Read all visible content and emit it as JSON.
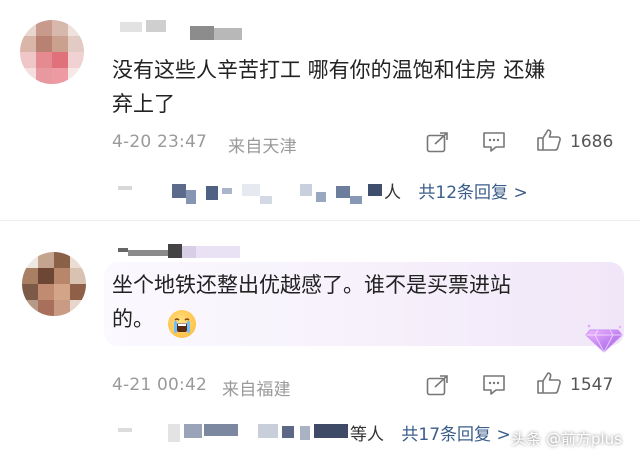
{
  "comments": [
    {
      "text_line1": "没有这些人辛苦打工 哪有你的温饱和住房 还嫌",
      "text_line2": "弃上了",
      "timestamp": "4-20 23:47",
      "source": "来自天津",
      "likes": "1686",
      "reply_suffix": "人",
      "reply_link": "共12条回复 >"
    },
    {
      "text_line1": "坐个地铁还整出优越感了。谁不是买票进站",
      "text_line2": "的。",
      "timestamp": "4-21 00:42",
      "source": "来自福建",
      "likes": "1547",
      "reply_suffix": "等人",
      "reply_link": "共17条回复 >"
    }
  ],
  "icons": {
    "share": "share-icon",
    "comment": "comment-icon",
    "like": "thumbs-up-icon",
    "emoji": "crying-face-emoji",
    "badge": "diamond-badge-icon"
  },
  "watermark": "头条 @前方plus",
  "colors": {
    "link": "#3b5d8a",
    "meta": "#9a9a9a"
  }
}
